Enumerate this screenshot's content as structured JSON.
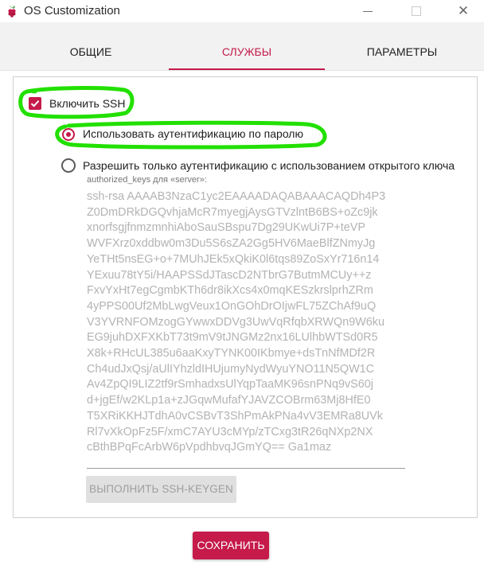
{
  "window": {
    "title": "OS Customization",
    "min_icon": "minimize-icon",
    "max_icon": "maximize-icon",
    "close_symbol": "✕"
  },
  "tabs": [
    {
      "label": "ОБЩИЕ",
      "active": false
    },
    {
      "label": "СЛУЖБЫ",
      "active": true
    },
    {
      "label": "ПАРАМЕТРЫ",
      "active": false
    }
  ],
  "ssh": {
    "enable_label": "Включить SSH",
    "enabled": true,
    "password_auth_label": "Использовать аутентификацию по паролю",
    "password_auth_selected": true,
    "pubkey_only_label": "Разрешить только аутентификацию с использованием открытого ключа",
    "pubkey_only_selected": false,
    "authorized_keys_label": "authorized_keys для «server»:",
    "authorized_keys_lines": [
      "ssh-rsa AAAAB3NzaC1yc2EAAAADAQABAAACAQDh4P3",
      "Z0DmDRkDGQvhjaMcR7myegjAysGTVzlntB6BS+oZc9jk",
      "xnorfsgjfnmzmnhiAboSauSBspu7Dg29UKwUi7P+teVP",
      "WVFXrz0xddbw0m3Du5S6sZA2Gg5HV6MaeBlfZNmyJg",
      "YeTHt5nsEG+o+7MUhJEk5xQkiK0l6tqs89ZoSxYr716n14",
      "YExuu78tY5i/HAAPSSdJTascD2NTbrG7ButmMCUy++z",
      "FxvYxHt7egCgmbKTh6dr8ikXcs4x0mqKESzkrslprhZRm",
      "4yPPS00Uf2MbLwgVeux1OnGOhDrOIjwFL75ZChAf9uQ",
      "V3YVRNFOMzogGYwwxDDVg3UwVqRfqbXRWQn9W6ku",
      "EG9juhDXFXKbT73t9mV9tJNGMz2nx16LUlhbWTSd0R5",
      "X8k+RHcUL385u6aaKxyTYNK00IKbmye+dsTnNfMDf2R",
      "Ch4udJxQsj/aUlIYhzldIHUjumyNydWyuYNO11N5QW1C",
      "Av4ZpQI9LIZ2tf9rSmhadxsUlYqpTaaMK96snPNq9vS60j",
      "d+jgEf/w2KLp1a+zJGqwMufafYJAVZCOBrm63Mj8HfE0",
      "T5XRiKKHJTdhA0vCSBvT3ShPmAkPNa4vV3EMRa8UVk",
      "Rl7vXkOpFz5F/xmC7AYU3cMYp/zTCxg3tR26qNXp2NX",
      "cBthBPqFcArbW6pVpdhbvqJGmYQ== Ga1maz"
    ],
    "keygen_label": "ВЫПОЛНИТЬ SSH-KEYGEN",
    "keygen_enabled": false
  },
  "footer": {
    "save_label": "СОХРАНИТЬ"
  },
  "colors": {
    "accent": "#c51a4a",
    "annotation": "#22e000",
    "disabled_text": "#b3b3b3"
  }
}
